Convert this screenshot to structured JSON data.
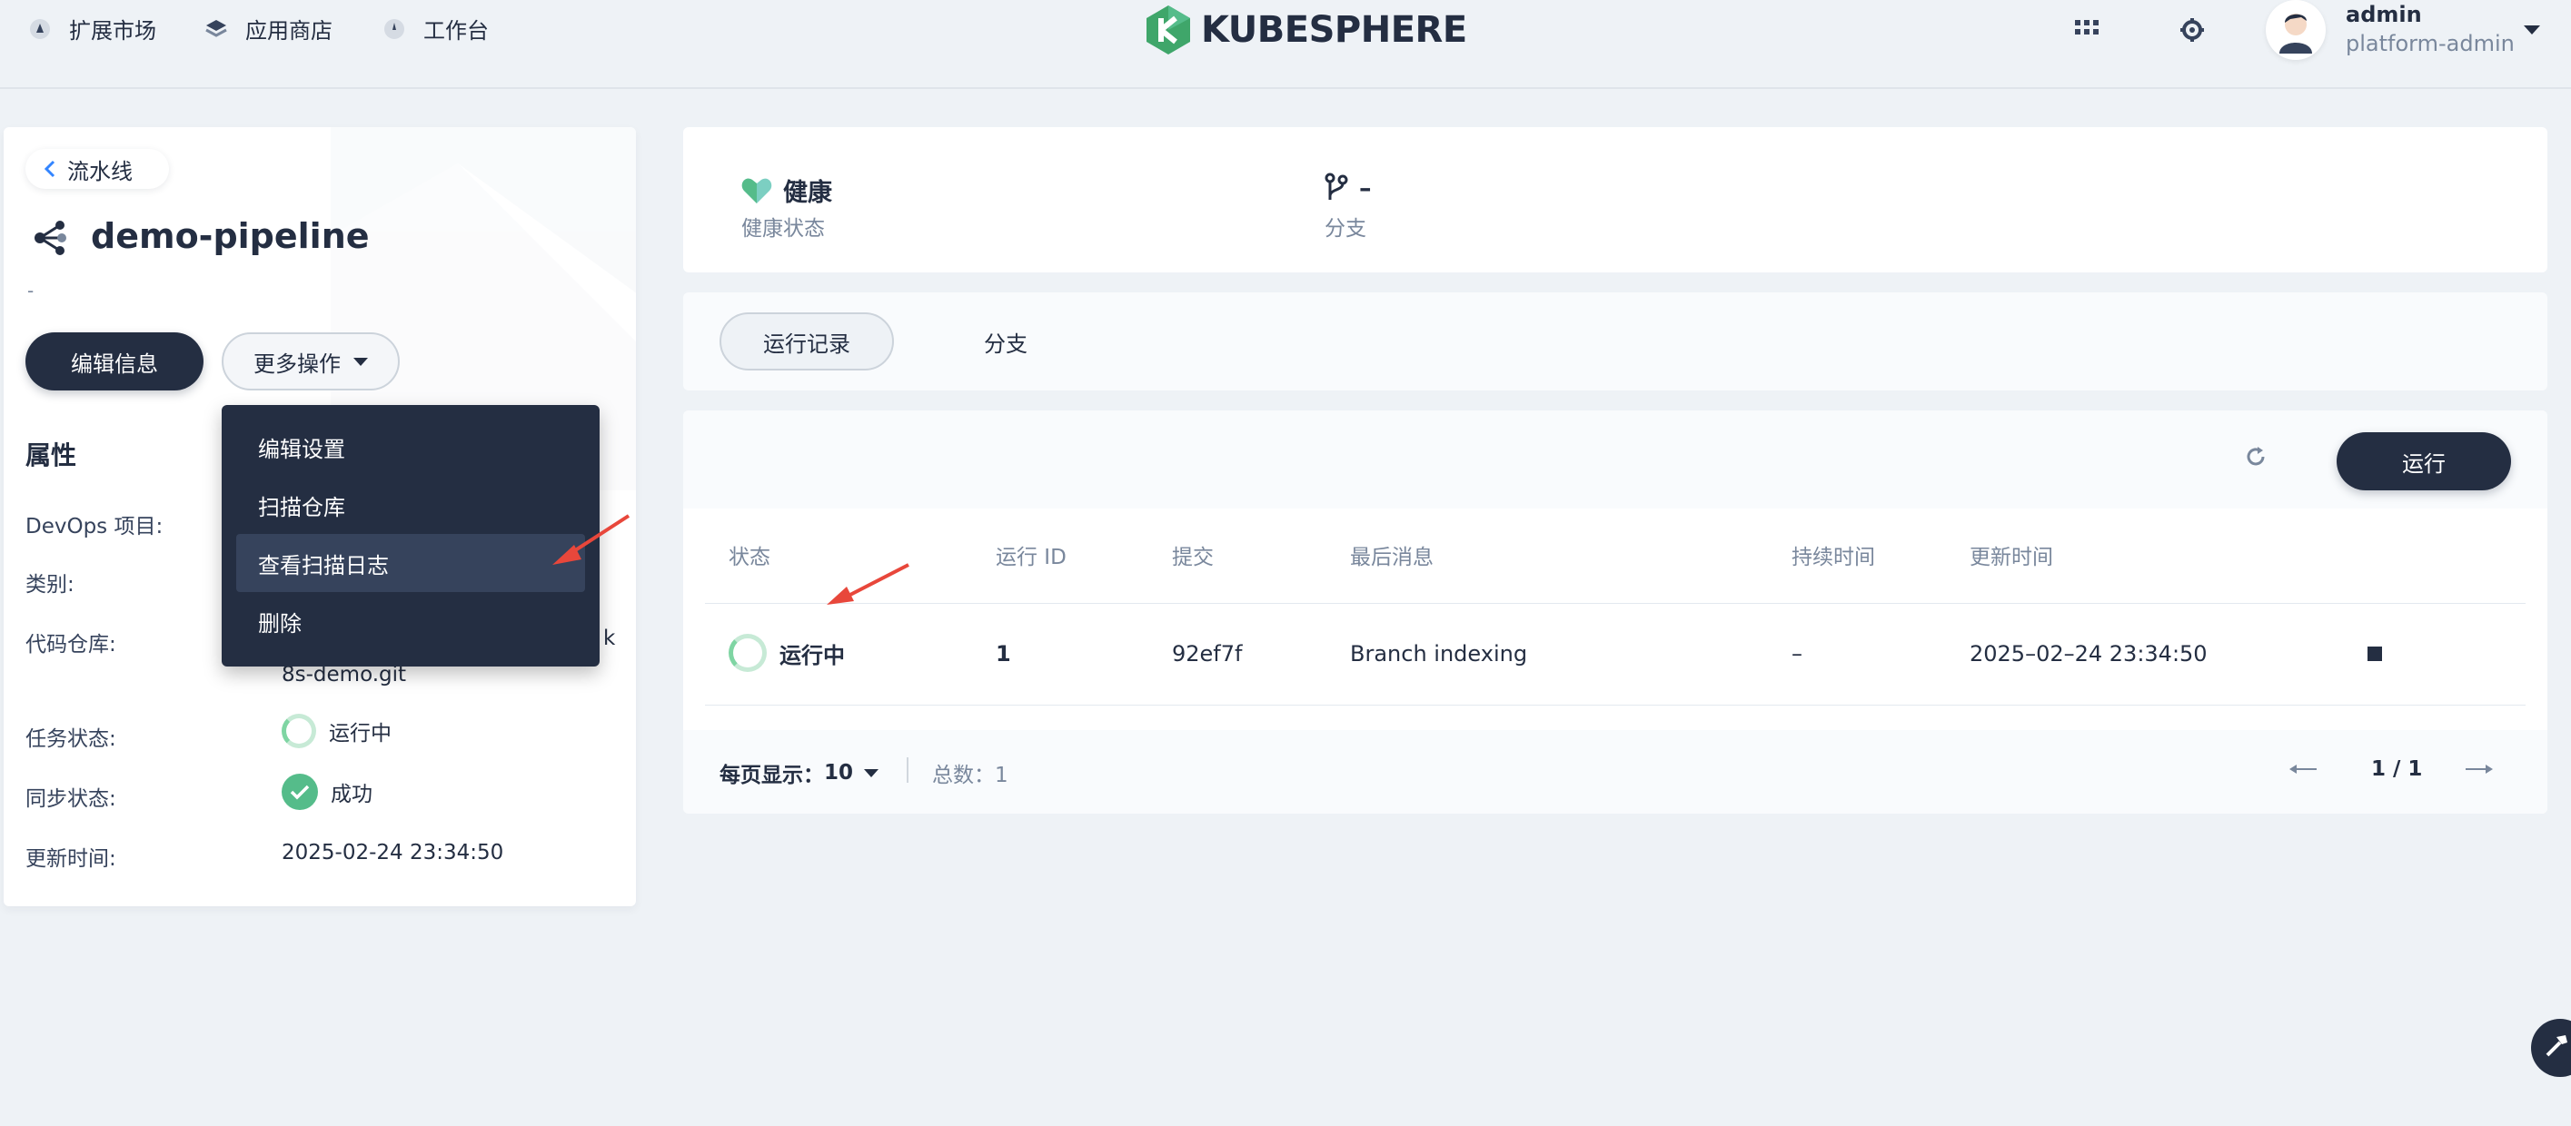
{
  "topbar": {
    "nav": [
      {
        "label": "扩展市场",
        "icon": "extension-market-icon"
      },
      {
        "label": "应用商店",
        "icon": "app-store-icon"
      },
      {
        "label": "工作台",
        "icon": "workbench-icon"
      }
    ],
    "logo_text": "KUBESPHERE",
    "user": {
      "name": "admin",
      "role": "platform-admin"
    }
  },
  "sidebar": {
    "back_label": "流水线",
    "pipeline_name": "demo-pipeline",
    "description": "-",
    "edit_button": "编辑信息",
    "more_button": "更多操作",
    "attributes_title": "属性",
    "attributes": [
      {
        "label": "DevOps 项目:",
        "value": ""
      },
      {
        "label": "类别:",
        "value": ""
      },
      {
        "label": "代码仓库:",
        "value": "k",
        "value_line2": "8s-demo.git"
      },
      {
        "label": "任务状态:",
        "value": "运行中"
      },
      {
        "label": "同步状态:",
        "value": "成功"
      },
      {
        "label": "更新时间:",
        "value": "2025-02-24 23:34:50"
      }
    ]
  },
  "dropdown": {
    "items": [
      "编辑设置",
      "扫描仓库",
      "查看扫描日志",
      "删除"
    ],
    "highlighted": "查看扫描日志"
  },
  "health": {
    "status_value": "健康",
    "status_label": "健康状态",
    "branch_value": "–",
    "branch_label": "分支"
  },
  "tabs": [
    {
      "label": "运行记录",
      "active": true
    },
    {
      "label": "分支",
      "active": false
    }
  ],
  "runs": {
    "run_button": "运行",
    "columns": [
      "状态",
      "运行 ID",
      "提交",
      "最后消息",
      "持续时间",
      "更新时间"
    ],
    "rows": [
      {
        "status": "运行中",
        "run_id": "1",
        "commit": "92ef7f",
        "message": "Branch indexing",
        "duration": "–",
        "updated": "2025–02–24 23:34:50"
      }
    ],
    "pagination": {
      "page_size_label": "每页显示：",
      "page_size": "10",
      "total_label": "总数：1",
      "page_indicator": "1 / 1"
    }
  },
  "colors": {
    "primary_dark": "#242e42",
    "success_green": "#55bc8a",
    "annotation_red": "#e8473b",
    "page_bg": "#eef2f6"
  }
}
